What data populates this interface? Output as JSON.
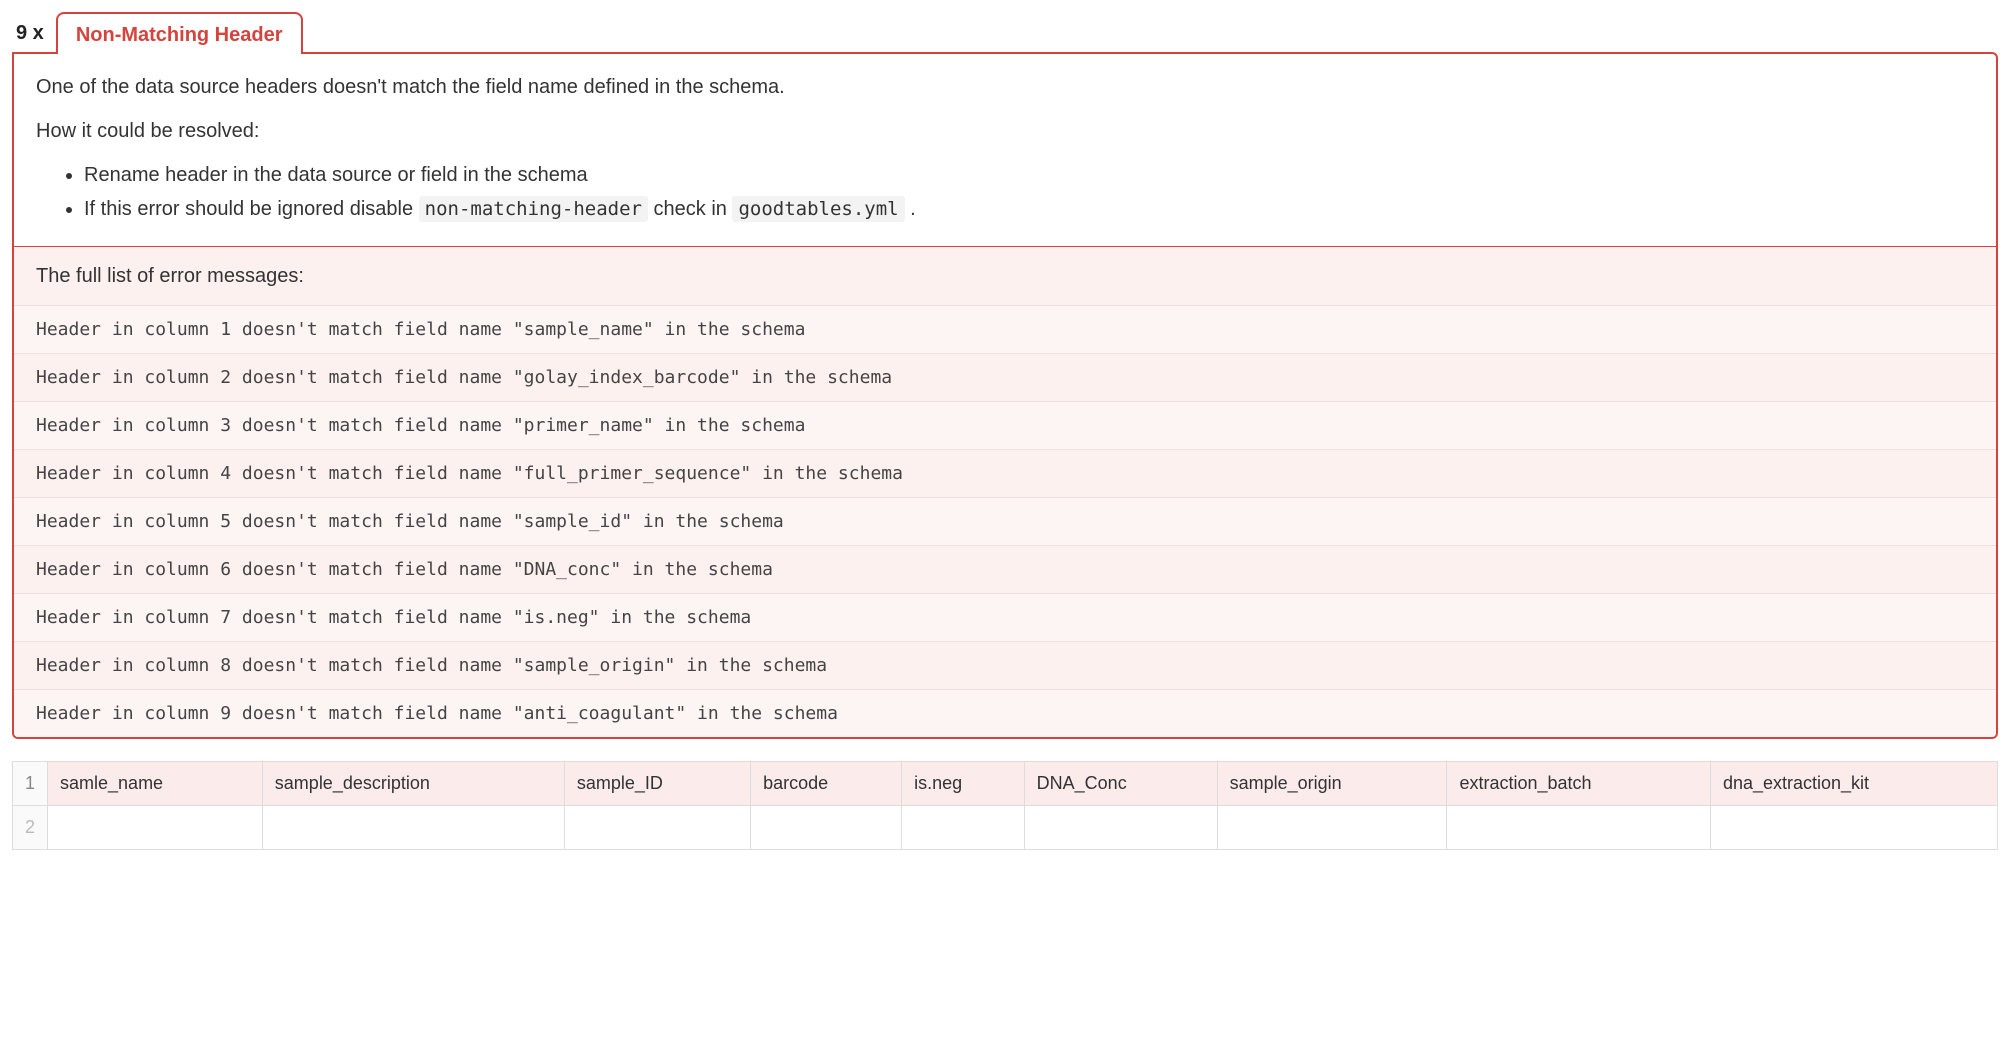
{
  "error": {
    "count": "9 x",
    "title": "Non-Matching Header",
    "summary": "One of the data source headers doesn't match the field name defined in the schema.",
    "resolve_intro": "How it could be resolved:",
    "resolutions": [
      "Rename header in the data source or field in the schema",
      "If this error should be ignored disable "
    ],
    "resolution2_code1": "non-matching-header",
    "resolution2_mid": " check in ",
    "resolution2_code2": "goodtables.yml",
    "resolution2_tail": " .",
    "list_header": "The full list of error messages:",
    "messages": [
      "Header in column 1 doesn't match field name \"sample_name\" in the schema",
      "Header in column 2 doesn't match field name \"golay_index_barcode\" in the schema",
      "Header in column 3 doesn't match field name \"primer_name\" in the schema",
      "Header in column 4 doesn't match field name \"full_primer_sequence\" in the schema",
      "Header in column 5 doesn't match field name \"sample_id\" in the schema",
      "Header in column 6 doesn't match field name \"DNA_conc\" in the schema",
      "Header in column 7 doesn't match field name \"is.neg\" in the schema",
      "Header in column 8 doesn't match field name \"sample_origin\" in the schema",
      "Header in column 9 doesn't match field name \"anti_coagulant\" in the schema"
    ]
  },
  "table": {
    "row1_label": "1",
    "row2_label": "2",
    "headers": [
      "samle_name",
      "sample_description",
      "sample_ID",
      "barcode",
      "is.neg",
      "DNA_Conc",
      "sample_origin",
      "extraction_batch",
      "dna_extraction_kit"
    ]
  }
}
